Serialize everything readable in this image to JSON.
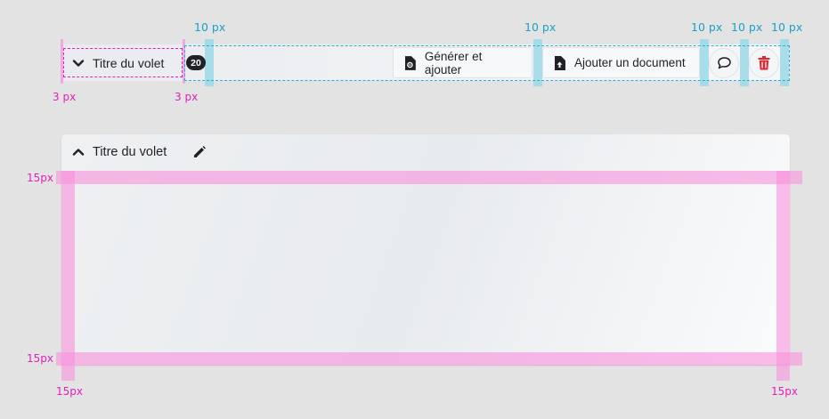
{
  "spacing_labels": {
    "cyan": [
      "10 px",
      "10 px",
      "10 px",
      "10 px",
      "10 px"
    ],
    "pink_top": [
      "3 px",
      "3 px"
    ],
    "pink_side_left": [
      "15px",
      "15px"
    ],
    "pink_bottom": [
      "15px",
      "15px"
    ]
  },
  "collapsed_bar": {
    "title": "Titre du volet",
    "badge": "20",
    "generate_label": "Générer et ajouter",
    "add_doc_label": "Ajouter un document"
  },
  "expanded_panel": {
    "title": "Titre du volet"
  },
  "colors": {
    "accent_cyan": "#1aa0c8",
    "accent_pink": "#e020b8",
    "delete_red": "#e0252c",
    "text_dark": "#1e2226"
  }
}
